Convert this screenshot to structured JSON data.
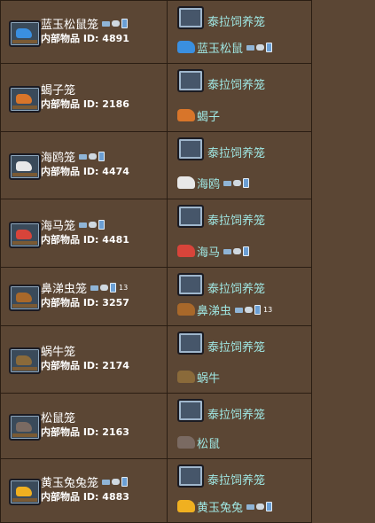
{
  "id_label": "内部物品 ID:",
  "rows": [
    {
      "item_name": "蓝玉松鼠笼",
      "item_id": "4891",
      "source": "泰拉饲养笼",
      "critter": "蓝玉松鼠",
      "count": "",
      "pc": true,
      "pad": true,
      "phone": true,
      "color": "#3a8fe0",
      "item_icon": "sapphire-squirrel-cage-icon",
      "critter_icon": "sapphire-squirrel-icon"
    },
    {
      "item_name": "蝎子笼",
      "item_id": "2186",
      "source": "泰拉饲养笼",
      "critter": "蝎子",
      "count": "",
      "pc": false,
      "pad": false,
      "phone": false,
      "color": "#d8752a",
      "item_icon": "scorpion-cage-icon",
      "critter_icon": "scorpion-icon"
    },
    {
      "item_name": "海鸥笼",
      "item_id": "4474",
      "source": "泰拉饲养笼",
      "critter": "海鸥",
      "count": "",
      "pc": true,
      "pad": true,
      "phone": true,
      "color": "#e8e8e8",
      "item_icon": "seagull-cage-icon",
      "critter_icon": "seagull-icon"
    },
    {
      "item_name": "海马笼",
      "item_id": "4481",
      "source": "泰拉饲养笼",
      "critter": "海马",
      "count": "",
      "pc": true,
      "pad": true,
      "phone": true,
      "color": "#d8443a",
      "item_icon": "seahorse-cage-icon",
      "critter_icon": "seahorse-icon"
    },
    {
      "item_name": "鼻涕虫笼",
      "item_id": "3257",
      "source": "泰拉饲养笼",
      "critter": "鼻涕虫",
      "count": "13",
      "pc": true,
      "pad": true,
      "phone": true,
      "color": "#a8682a",
      "item_icon": "grubby-cage-icon",
      "critter_icon": "grubby-icon"
    },
    {
      "item_name": "蜗牛笼",
      "item_id": "2174",
      "source": "泰拉饲养笼",
      "critter": "蜗牛",
      "count": "",
      "pc": false,
      "pad": false,
      "phone": false,
      "color": "#8a6a3a",
      "item_icon": "snail-cage-icon",
      "critter_icon": "snail-icon"
    },
    {
      "item_name": "松鼠笼",
      "item_id": "2163",
      "source": "泰拉饲养笼",
      "critter": "松鼠",
      "count": "",
      "pc": false,
      "pad": false,
      "phone": false,
      "color": "#7a6a62",
      "item_icon": "squirrel-cage-icon",
      "critter_icon": "squirrel-icon"
    },
    {
      "item_name": "黄玉兔兔笼",
      "item_id": "4883",
      "source": "泰拉饲养笼",
      "critter": "黄玉兔兔",
      "count": "",
      "pc": true,
      "pad": true,
      "phone": true,
      "color": "#f0b020",
      "item_icon": "topaz-bunny-cage-icon",
      "critter_icon": "topaz-bunny-icon"
    }
  ]
}
